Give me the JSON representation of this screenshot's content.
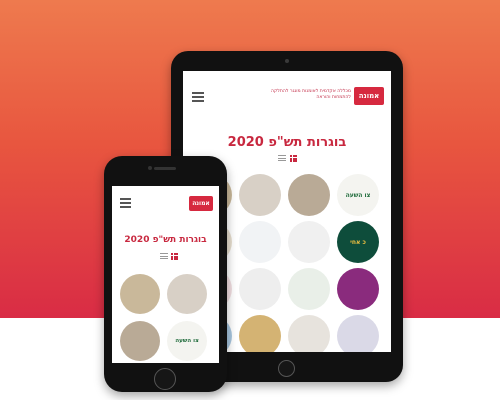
{
  "site": {
    "logo_text": "אמונה",
    "tagline": "מכללה אקדמית לאומנות מונגר להתלקה להתמחות והוראה",
    "page_title": "בוגרות תש\"פ 2020"
  },
  "thumbnails": [
    {
      "name": "thumb-sign-sketch",
      "color": "#c9b89a"
    },
    {
      "name": "thumb-weave",
      "color": "#d8d0c6"
    },
    {
      "name": "thumb-textile",
      "color": "#b9aa96"
    },
    {
      "name": "thumb-tzav-hashaa",
      "color": "#f4f4f0",
      "text": "צו השעה"
    },
    {
      "name": "thumb-books",
      "color": "#e8dfcf"
    },
    {
      "name": "thumb-devices",
      "color": "#f1f3f5"
    },
    {
      "name": "thumb-envelope",
      "color": "#f0f0f0"
    },
    {
      "name": "thumb-green-logo",
      "color": "#0e4d3b",
      "text": "כ אחי"
    },
    {
      "name": "thumb-flowers",
      "color": "#f2dfe2"
    },
    {
      "name": "thumb-logo-ao",
      "color": "#eeeeee"
    },
    {
      "name": "thumb-illustration",
      "color": "#e9efe8"
    },
    {
      "name": "thumb-purple-orange",
      "color": "#8a2b7d"
    },
    {
      "name": "thumb-sky-blue",
      "color": "#a8c7e0"
    },
    {
      "name": "thumb-gold",
      "color": "#d4b373"
    },
    {
      "name": "thumb-arch",
      "color": "#e7e3dd"
    },
    {
      "name": "thumb-wave",
      "color": "#dad9e7"
    }
  ],
  "colors": {
    "brand_red": "#d6293f",
    "accent": "#c8283f"
  }
}
